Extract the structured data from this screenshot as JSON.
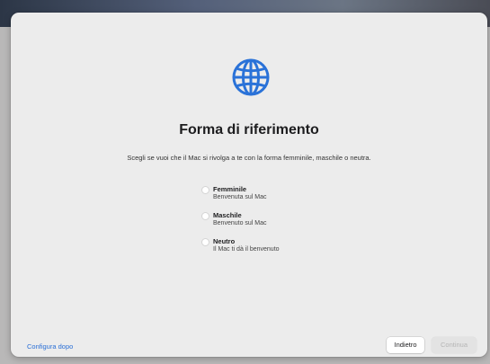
{
  "icon": "globe-icon",
  "accent_color": "#2a72d8",
  "title": "Forma di riferimento",
  "subtitle": "Scegli se vuoi che il Mac si rivolga a te con la forma femminile, maschile o neutra.",
  "options": [
    {
      "label": "Femminile",
      "description": "Benvenuta sul Mac"
    },
    {
      "label": "Maschile",
      "description": "Benvenuto sul Mac"
    },
    {
      "label": "Neutro",
      "description": "Il Mac ti dà il benvenuto"
    }
  ],
  "footer": {
    "setup_later": "Configura dopo",
    "back": "Indietro",
    "continue": "Continua"
  }
}
